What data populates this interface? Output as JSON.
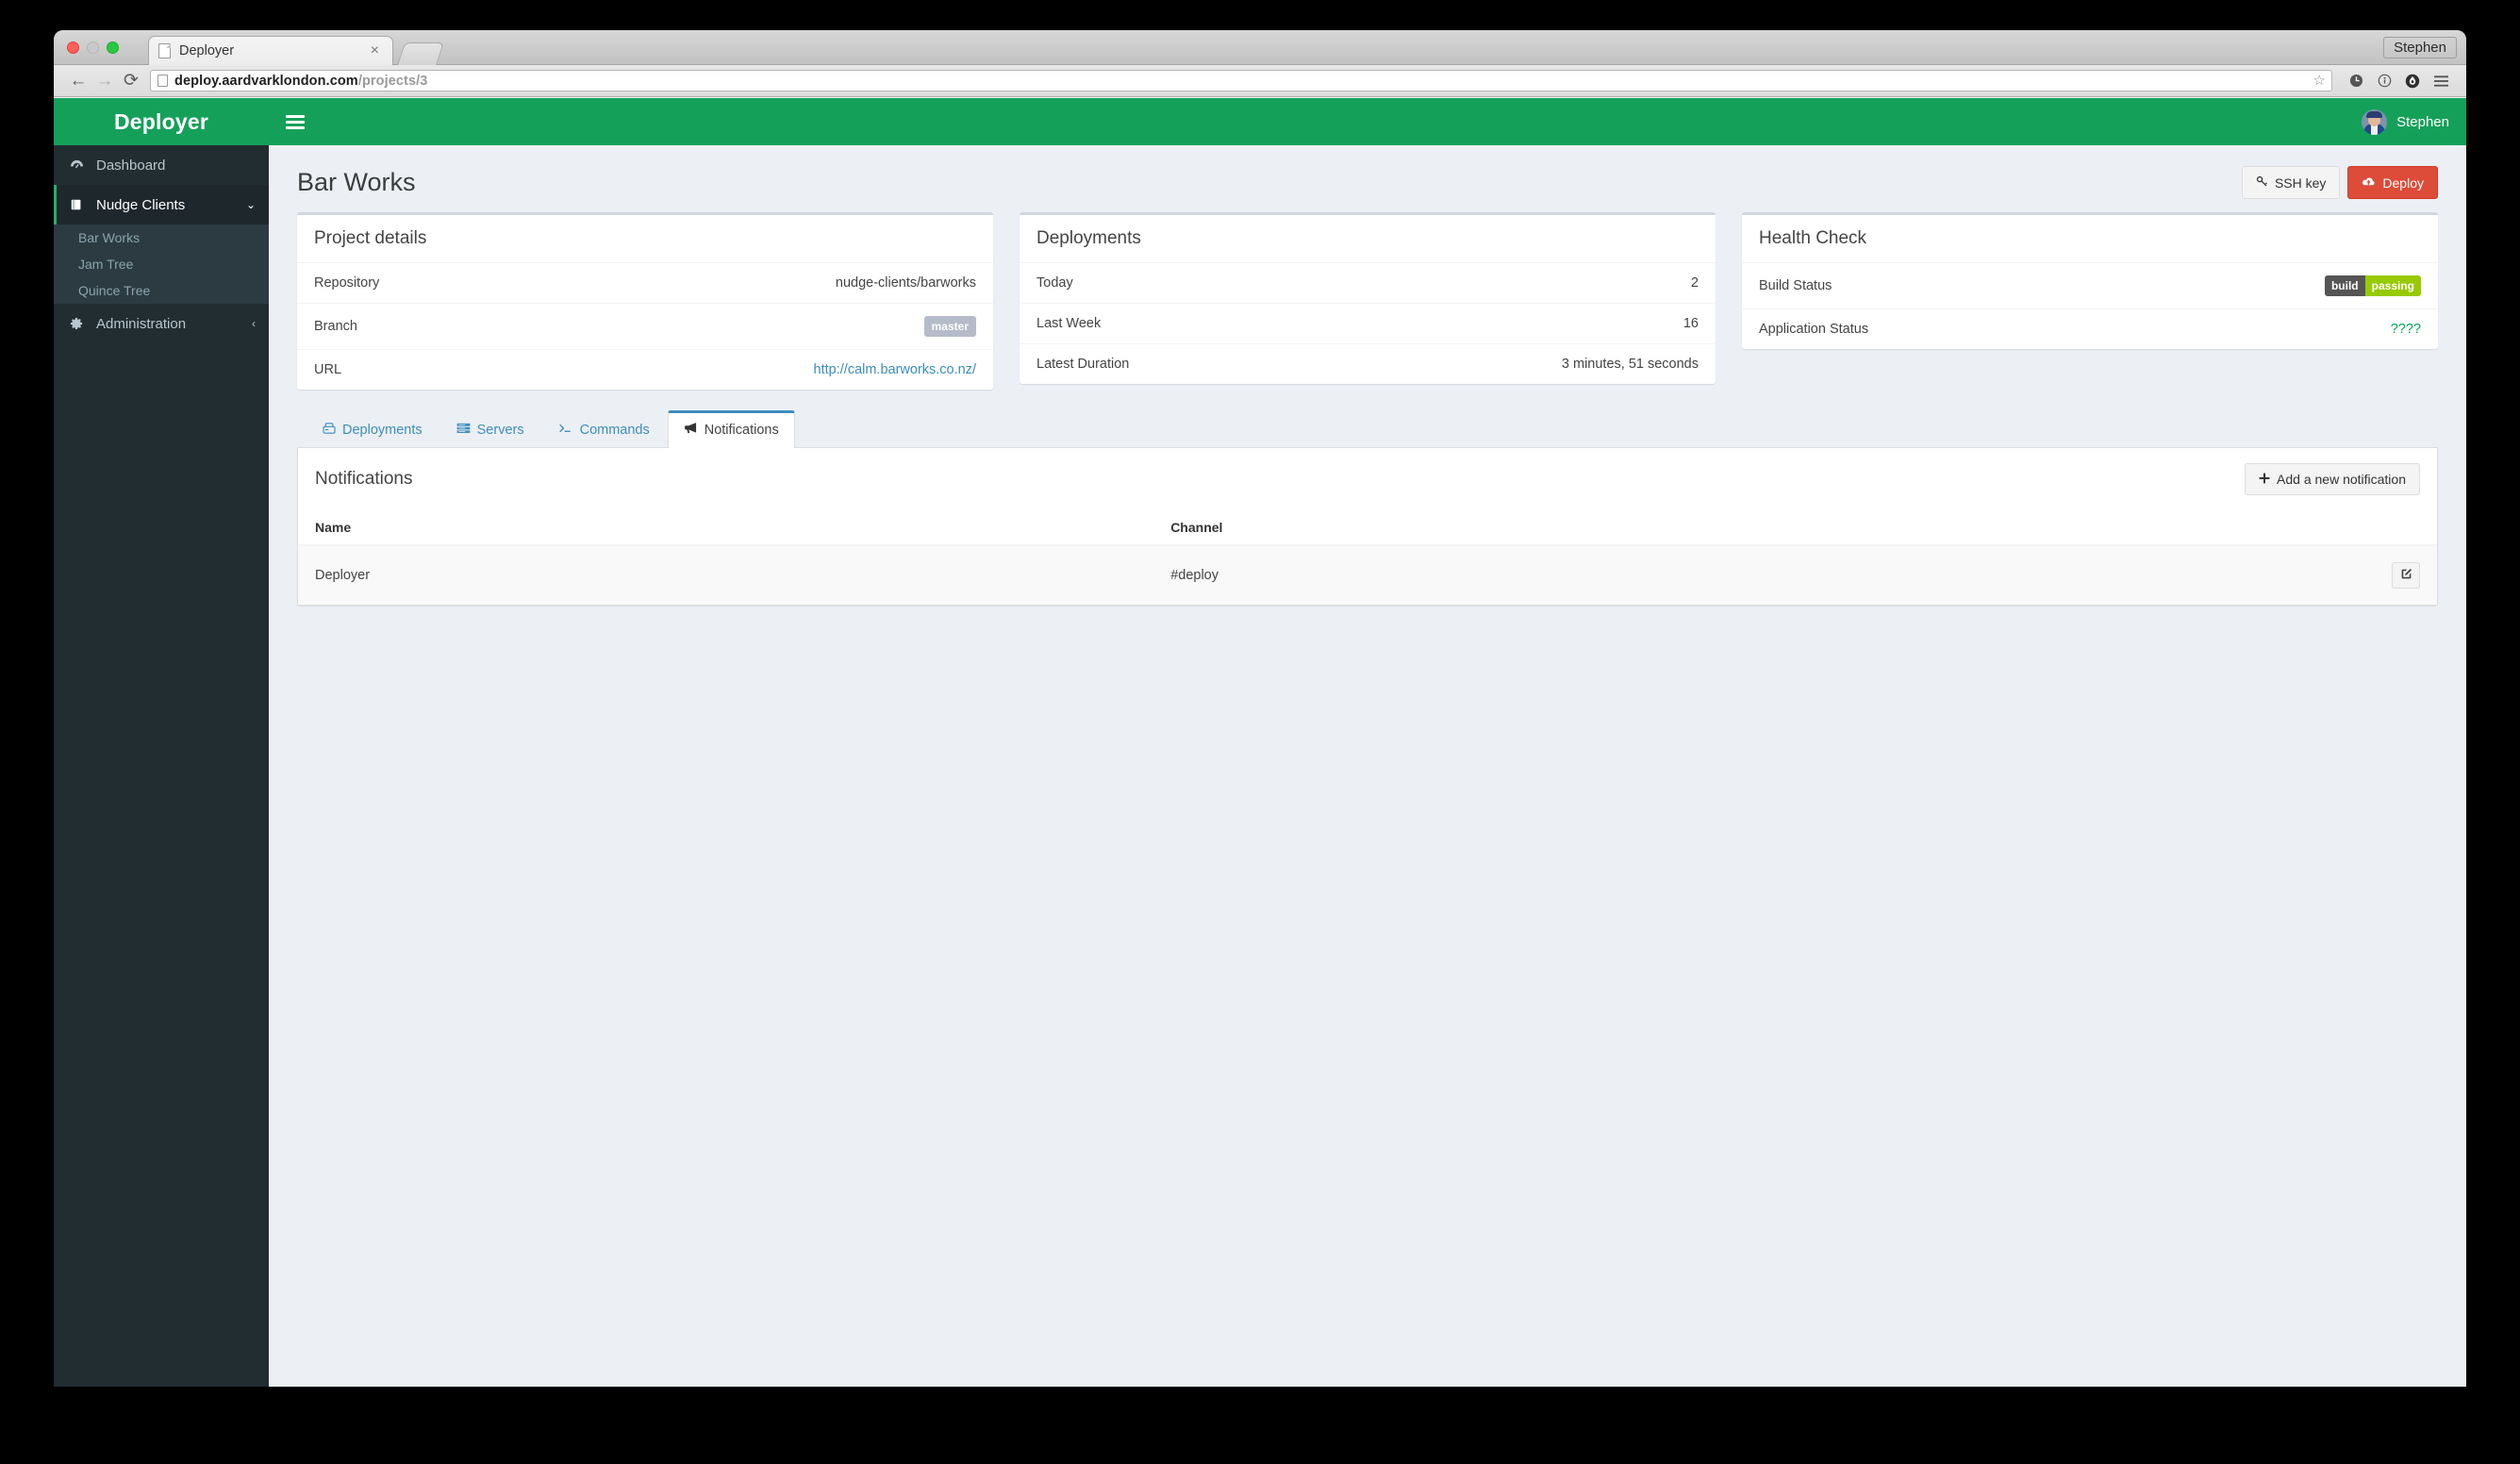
{
  "os": {
    "user_label": "Stephen"
  },
  "browser": {
    "tab_title": "Deployer",
    "tab_close": "×",
    "back_icon": "←",
    "forward_icon": "→",
    "reload_icon": "⟳",
    "url_main": "deploy.aardvarklondon.com",
    "url_path": "/projects/3",
    "star_icon": "☆",
    "toolbar_icons": [
      "clock-icon",
      "info-circle-icon",
      "flame-icon",
      "hamburger-menu-icon"
    ]
  },
  "sidebar": {
    "logo": "Deployer",
    "items": [
      {
        "label": "Dashboard",
        "icon": "dashboard-icon",
        "active": false,
        "caret": ""
      },
      {
        "label": "Nudge Clients",
        "icon": "book-icon",
        "active": true,
        "caret": "⌄"
      }
    ],
    "subitems": [
      {
        "label": "Bar Works"
      },
      {
        "label": "Jam Tree"
      },
      {
        "label": "Quince Tree"
      }
    ],
    "admin": {
      "label": "Administration",
      "icon": "gear-icon",
      "caret": "‹"
    }
  },
  "navbar": {
    "toggle_icon": "hamburger-menu-icon",
    "user_name": "Stephen"
  },
  "header": {
    "title": "Bar Works",
    "ssh_key_label": "SSH key",
    "deploy_label": "Deploy"
  },
  "project_details": {
    "title": "Project details",
    "rows": [
      {
        "label": "Repository",
        "value": "nudge-clients/barworks",
        "type": "text"
      },
      {
        "label": "Branch",
        "value": "master",
        "type": "badge"
      },
      {
        "label": "URL",
        "value": "http://calm.barworks.co.nz/",
        "type": "link"
      }
    ]
  },
  "deployments_panel": {
    "title": "Deployments",
    "rows": [
      {
        "label": "Today",
        "value": "2"
      },
      {
        "label": "Last Week",
        "value": "16"
      },
      {
        "label": "Latest Duration",
        "value": "3 minutes, 51 seconds"
      }
    ]
  },
  "health_check": {
    "title": "Health Check",
    "build_status_label": "Build Status",
    "build_badge_left": "build",
    "build_badge_right": "passing",
    "application_status_label": "Application Status",
    "application_status_value": "????"
  },
  "tabs": [
    {
      "label": "Deployments",
      "icon": "server-icon",
      "active": false
    },
    {
      "label": "Servers",
      "icon": "server-list-icon",
      "active": false
    },
    {
      "label": "Commands",
      "icon": "terminal-icon",
      "active": false
    },
    {
      "label": "Notifications",
      "icon": "bullhorn-icon",
      "active": true
    }
  ],
  "notifications": {
    "panel_title": "Notifications",
    "add_button_label": "Add a new notification",
    "add_button_icon": "plus-icon",
    "columns": [
      "Name",
      "Channel"
    ],
    "rows": [
      {
        "name": "Deployer",
        "channel": "#deploy",
        "edit_icon": "edit-pencil-square-icon"
      }
    ]
  },
  "colors": {
    "brand_green": "#15a05a",
    "sidebar_dark": "#222d32",
    "accent_blue": "#3c8dbc",
    "danger_red": "#dd4b39",
    "badge_green": "#97ca00",
    "status_green": "#00a65a",
    "page_bg": "#ecf0f5"
  }
}
